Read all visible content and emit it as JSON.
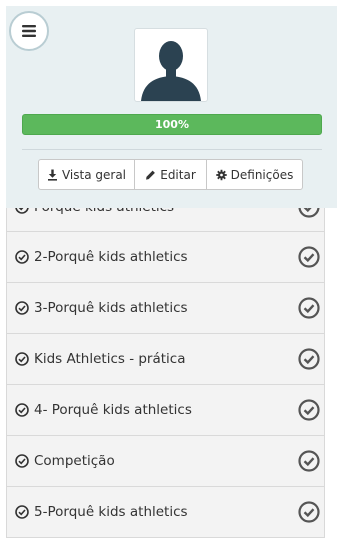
{
  "header": {
    "menu_icon": "hamburger-icon",
    "avatar_icon": "user-silhouette-icon",
    "progress": {
      "value": 1.0,
      "label": "100%",
      "color": "#5cb85c"
    },
    "buttons": {
      "overview": {
        "label": "Vista geral",
        "icon": "download-icon"
      },
      "edit": {
        "label": "Editar",
        "icon": "pencil-icon"
      },
      "settings": {
        "label": "Definições",
        "icon": "gear-icon"
      }
    }
  },
  "list": {
    "items": [
      {
        "label": "Porquê kids athletics"
      },
      {
        "label": "2-Porquê kids athletics"
      },
      {
        "label": "3-Porquê kids athletics"
      },
      {
        "label": "Kids Athletics - prática"
      },
      {
        "label": "4- Porquê kids athletics"
      },
      {
        "label": "Competição"
      },
      {
        "label": "5-Porquê kids athletics"
      }
    ],
    "item_icon": "check-circle-icon",
    "status_icon": "check-circle-icon"
  }
}
